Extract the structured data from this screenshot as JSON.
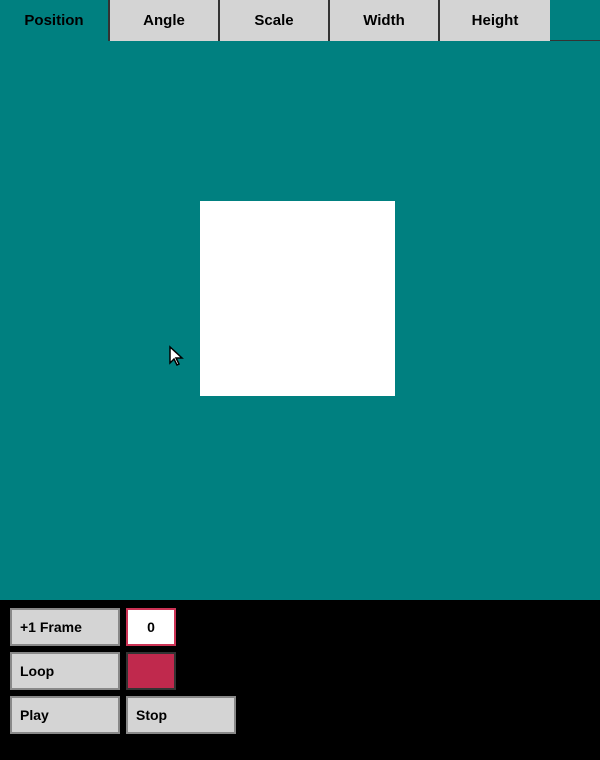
{
  "header": {
    "tabs": [
      {
        "id": "position",
        "label": "Position"
      },
      {
        "id": "angle",
        "label": "Angle"
      },
      {
        "id": "scale",
        "label": "Scale"
      },
      {
        "id": "width",
        "label": "Width"
      },
      {
        "id": "height",
        "label": "Height"
      }
    ]
  },
  "canvas": {
    "bg_color": "#008080",
    "rect": {
      "bg_color": "#ffffff"
    }
  },
  "controls": {
    "frame_btn_label": "+1 Frame",
    "frame_value": "0",
    "loop_btn_label": "Loop",
    "loop_color": "#c0294d",
    "play_btn_label": "Play",
    "stop_btn_label": "Stop"
  },
  "icons": {
    "cursor": "&#9654;"
  }
}
